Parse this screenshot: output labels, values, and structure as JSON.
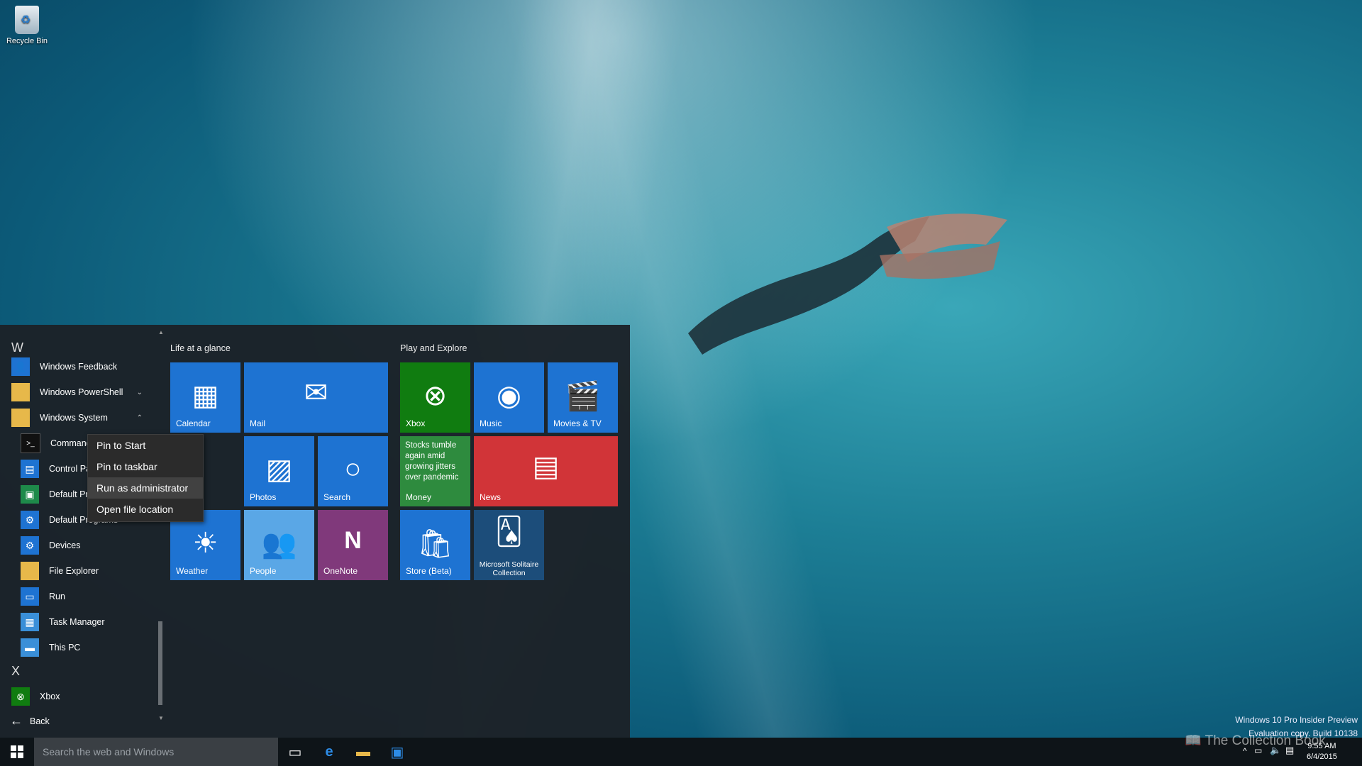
{
  "desktop": {
    "recycle_bin_label": "Recycle Bin"
  },
  "start_menu": {
    "letters": [
      "W",
      "X"
    ],
    "apps": [
      {
        "label": "Windows Feedback",
        "icon": "feedback-icon",
        "color": "#1e73d2"
      },
      {
        "label": "Windows PowerShell",
        "icon": "folder-icon",
        "color": "#e7b84a"
      },
      {
        "label": "Windows System",
        "icon": "folder-icon",
        "color": "#e7b84a"
      },
      {
        "label": "Command",
        "icon": "cmd-icon",
        "color": "#111111"
      },
      {
        "label": "Control Pa",
        "icon": "control-panel-icon",
        "color": "#1e73d2"
      },
      {
        "label": "Default Pr",
        "icon": "default-programs-icon",
        "color": "#1e8a4a"
      },
      {
        "label": "Default Programs",
        "icon": "gear-icon",
        "color": "#1e73d2"
      },
      {
        "label": "Devices",
        "icon": "gear-icon",
        "color": "#1e73d2"
      },
      {
        "label": "File Explorer",
        "icon": "folder-icon",
        "color": "#e7b84a"
      },
      {
        "label": "Run",
        "icon": "run-icon",
        "color": "#1e73d2"
      },
      {
        "label": "Task Manager",
        "icon": "task-manager-icon",
        "color": "#3a8fd8"
      },
      {
        "label": "This PC",
        "icon": "pc-icon",
        "color": "#3a8fd8"
      },
      {
        "label": "Xbox",
        "icon": "xbox-icon",
        "color": "#107c10"
      }
    ],
    "back_label": "Back",
    "context_menu": [
      "Pin to Start",
      "Pin to taskbar",
      "Run as administrator",
      "Open file location"
    ],
    "groups": [
      "Life at a glance",
      "Play and Explore"
    ],
    "tiles": {
      "calendar": "Calendar",
      "mail": "Mail",
      "photos": "Photos",
      "search": "Search",
      "weather": "Weather",
      "people": "People",
      "onenote": "OneNote",
      "xbox": "Xbox",
      "music": "Music",
      "movies": "Movies & TV",
      "money": "Money",
      "money_headline": "Stocks tumble again amid growing jitters over pandemic",
      "news": "News",
      "store": "Store (Beta)",
      "solitaire": "Microsoft Solitaire Collection"
    }
  },
  "taskbar": {
    "search_placeholder": "Search the web and Windows",
    "time": "9:55 AM",
    "date": "6/4/2015"
  },
  "watermark": {
    "line1": "Windows 10 Pro Insider Preview",
    "line2": "Evaluation copy. Build 10138",
    "brand": "The Collection Book"
  },
  "colors": {
    "accent": "#1e73d2",
    "xbox": "#107c10",
    "money": "#2e8b3e",
    "news": "#d13438",
    "onenote": "#80397b",
    "people": "#5aa7e6"
  }
}
